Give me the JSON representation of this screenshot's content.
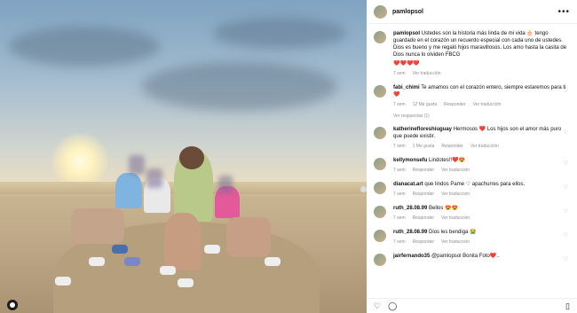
{
  "post": {
    "username": "pamlopsol",
    "more_icon": "more-icon",
    "caption": "Ustedes son la historia más linda de mi vida 🎂 tengo guardado en el corazón un recuerdo especial con cada uno de ustedes. Dios es bueno y me regaló hijos maravillosos. Los amo hasta la casita de Dios nunca lo olviden FBCG",
    "caption_hearts": "❤️❤️❤️❤️",
    "caption_time": "7 sem",
    "caption_translate": "Ver traducción"
  },
  "comments": [
    {
      "user": "fabi_chimi",
      "text": "Te amamos con el corazón entero, siempre estaremos para ti ❤️",
      "time": "7 sem",
      "likes": "12 Me gusta",
      "reply": "Responder",
      "translate": "Ver traducción"
    },
    {
      "user": "katherinefloreshiuguay",
      "text": "Hermosos ❤️ Los hijos son el amor más puro que puede existir.",
      "time": "7 sem",
      "likes": "1 Me gusta",
      "reply": "Responder",
      "translate": "Ver traducción"
    },
    {
      "user": "kellymonsefu",
      "text": "Lindotes!!❤️😍",
      "time": "7 sem",
      "likes": "",
      "reply": "Responder",
      "translate": "Ver traducción"
    },
    {
      "user": "dianacat.art",
      "text": "que lindos Pame ♡ apachurres para ellos.",
      "time": "7 sem",
      "likes": "",
      "reply": "Responder",
      "translate": "Ver traducción"
    },
    {
      "user": "ruth_28.08.99",
      "text": "Bellos 😍😍",
      "time": "7 sem",
      "likes": "",
      "reply": "Responder",
      "translate": "Ver traducción"
    },
    {
      "user": "ruth_28.08.99",
      "text": "Dios les bendiga 😭",
      "time": "7 sem",
      "likes": "",
      "reply": "Responder",
      "translate": "Ver traducción"
    },
    {
      "user": "jairfernando35",
      "text": "@pamlopsol Bonita Foto❤️..",
      "time": "",
      "likes": "",
      "reply": "",
      "translate": ""
    }
  ],
  "view_replies": "Ver respuestas (1)",
  "actions": {
    "like_icon": "heart-icon",
    "comment_icon": "comment-icon",
    "bookmark_icon": "bookmark-icon"
  }
}
